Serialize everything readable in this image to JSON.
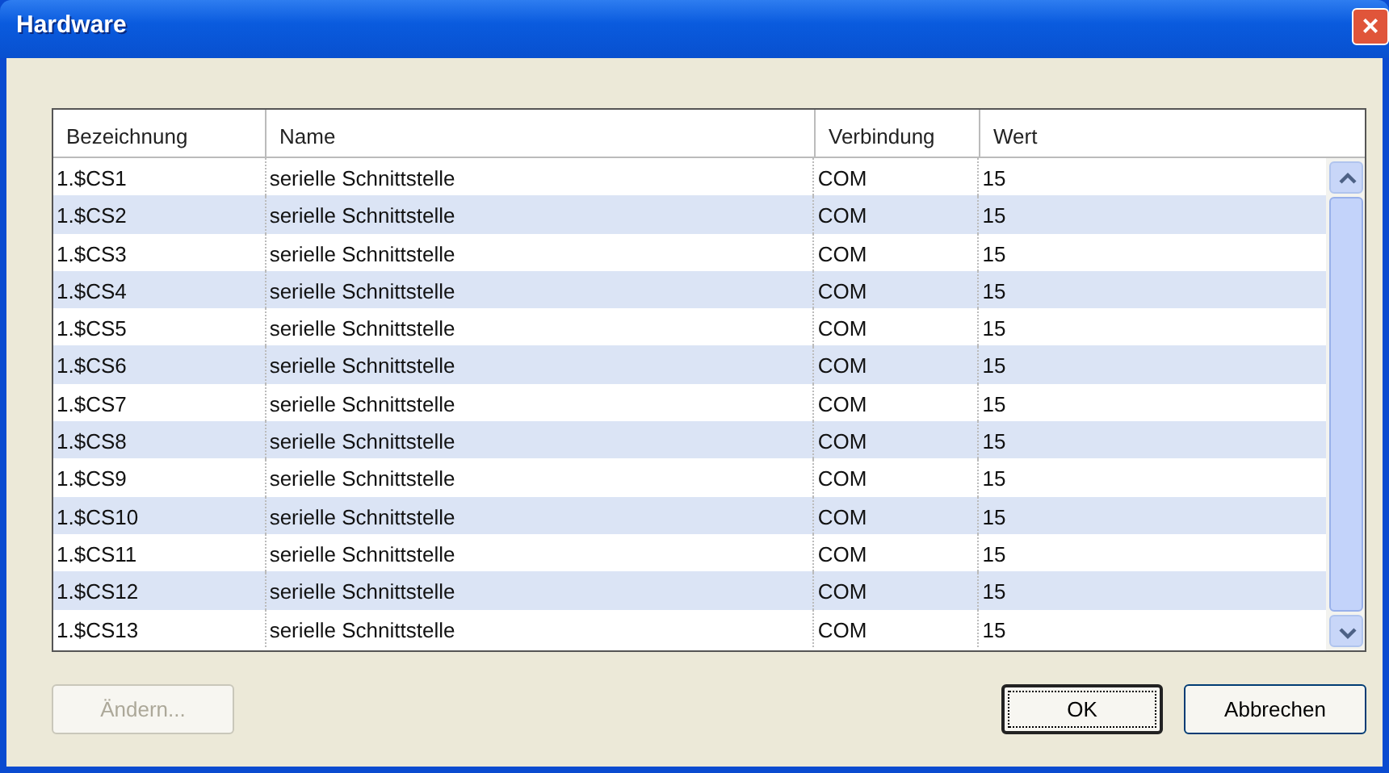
{
  "window": {
    "title": "Hardware",
    "close_label": "×"
  },
  "table": {
    "columns": [
      "Bezeichnung",
      "Name",
      "Verbindung",
      "Wert"
    ],
    "rows": [
      [
        "1.$CS1",
        "serielle Schnittstelle",
        "COM",
        "15"
      ],
      [
        "1.$CS2",
        "serielle Schnittstelle",
        "COM",
        "15"
      ],
      [
        "1.$CS3",
        "serielle Schnittstelle",
        "COM",
        "15"
      ],
      [
        "1.$CS4",
        "serielle Schnittstelle",
        "COM",
        "15"
      ],
      [
        "1.$CS5",
        "serielle Schnittstelle",
        "COM",
        "15"
      ],
      [
        "1.$CS6",
        "serielle Schnittstelle",
        "COM",
        "15"
      ],
      [
        "1.$CS7",
        "serielle Schnittstelle",
        "COM",
        "15"
      ],
      [
        "1.$CS8",
        "serielle Schnittstelle",
        "COM",
        "15"
      ],
      [
        "1.$CS9",
        "serielle Schnittstelle",
        "COM",
        "15"
      ],
      [
        "1.$CS10",
        "serielle Schnittstelle",
        "COM",
        "15"
      ],
      [
        "1.$CS11",
        "serielle Schnittstelle",
        "COM",
        "15"
      ],
      [
        "1.$CS12",
        "serielle Schnittstelle",
        "COM",
        "15"
      ],
      [
        "1.$CS13",
        "serielle Schnittstelle",
        "COM",
        "15"
      ]
    ]
  },
  "buttons": [
    {
      "label": "Ändern...",
      "disabled": true,
      "default": false
    },
    {
      "label": "OK",
      "disabled": false,
      "default": true
    },
    {
      "label": "Abbrechen",
      "disabled": false,
      "default": false
    }
  ]
}
